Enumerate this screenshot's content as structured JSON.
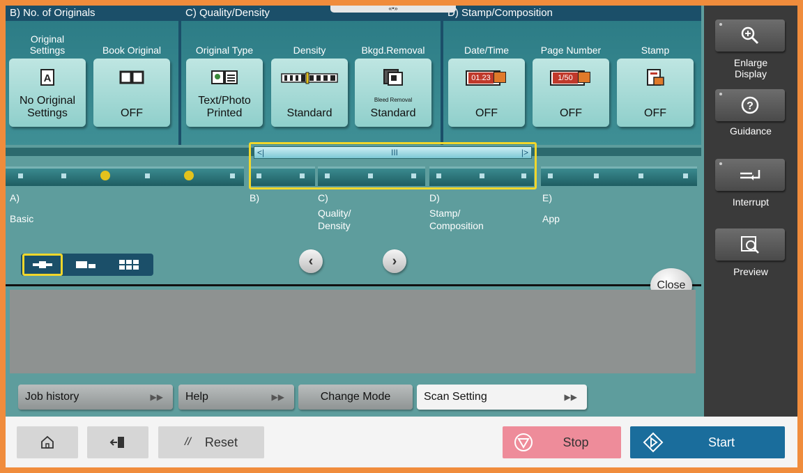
{
  "groups": {
    "b": "B)  No. of Originals",
    "c": "C)  Quality/Density",
    "d": "D)  Stamp/Composition",
    "handle": "«•»"
  },
  "settings": [
    {
      "label": "Original\nSettings",
      "value": "No Original Settings",
      "icon": "original-settings-icon"
    },
    {
      "label": "Book Original",
      "value": "OFF",
      "icon": "book-icon"
    },
    {
      "label": "Original Type",
      "value": "Text/Photo Printed",
      "icon": "original-type-icon"
    },
    {
      "label": "Density",
      "value": "Standard",
      "icon": "density-scale-icon"
    },
    {
      "label": "Bkgd.Removal",
      "value": "Standard",
      "sub": "Bleed Removal",
      "icon": "background-removal-icon"
    },
    {
      "label": "Date/Time",
      "value": "OFF",
      "icon_text": "01.23",
      "icon": "date-time-icon"
    },
    {
      "label": "Page Number",
      "value": "OFF",
      "icon_text": "1/50",
      "icon": "page-number-icon"
    },
    {
      "label": "Stamp",
      "value": "OFF",
      "icon": "stamp-icon"
    }
  ],
  "navigator": {
    "bar_left": "<|",
    "bar_mid": "III",
    "bar_right": "|>",
    "labels": {
      "a1": "A)",
      "a2": "Basic",
      "b1": "B)",
      "c1": "C)",
      "c2": "Quality/",
      "c3": "Density",
      "d1": "D)",
      "d2": "Stamp/",
      "d3": "Composition",
      "e1": "E)",
      "e2": "App"
    }
  },
  "close_label": "Close",
  "tabs": {
    "job_history": "Job history",
    "help": "Help",
    "change_mode": "Change Mode",
    "scan_setting": "Scan Setting"
  },
  "side": {
    "enlarge": "Enlarge\nDisplay",
    "guidance": "Guidance",
    "interrupt": "Interrupt",
    "preview": "Preview"
  },
  "bottom": {
    "reset": "Reset",
    "stop": "Stop",
    "start": "Start"
  },
  "colors": {
    "accent": "#f1d72b",
    "start": "#1a6d9c",
    "stop": "#ee8c9a",
    "frame": "#f08c3c"
  }
}
